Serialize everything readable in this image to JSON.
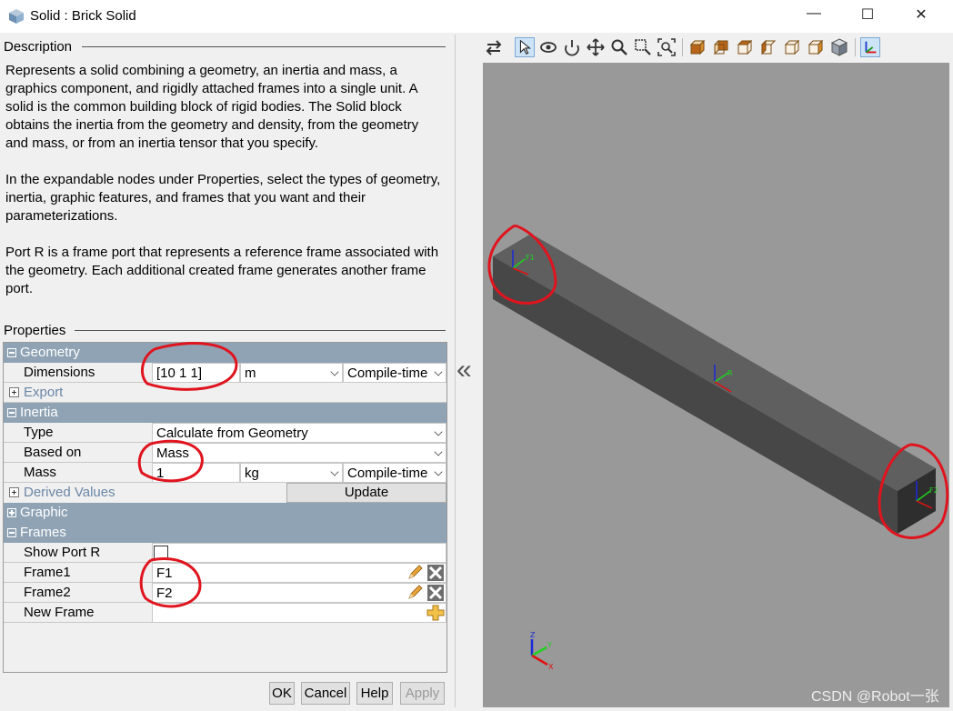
{
  "window": {
    "title": "Solid : Brick Solid",
    "controls": [
      "—",
      "☐",
      "✕"
    ]
  },
  "description": {
    "heading": "Description",
    "paragraphs": [
      "Represents a solid combining a geometry, an inertia and mass, a graphics component, and rigidly attached frames into a single unit. A solid is the common building block of rigid bodies. The Solid block obtains the inertia from the geometry and density, from the geometry and mass, or from an inertia tensor that you specify.",
      "In the expandable nodes under Properties, select the types of geometry, inertia, graphic features, and frames that you want and their parameterizations.",
      "Port R is a frame port that represents a reference frame associated with the geometry. Each additional created frame generates another frame port."
    ]
  },
  "properties": {
    "heading": "Properties",
    "geometry": {
      "label": "Geometry",
      "dimensions": {
        "label": "Dimensions",
        "value": "[10 1 1]",
        "unit": "m",
        "mode": "Compile-time"
      }
    },
    "export": {
      "label": "Export"
    },
    "inertia": {
      "label": "Inertia",
      "type": {
        "label": "Type",
        "value": "Calculate from Geometry"
      },
      "based_on": {
        "label": "Based on",
        "value": "Mass"
      },
      "mass": {
        "label": "Mass",
        "value": "1",
        "unit": "kg",
        "mode": "Compile-time"
      }
    },
    "derived": {
      "label": "Derived Values",
      "button": "Update"
    },
    "graphic": {
      "label": "Graphic"
    },
    "frames": {
      "label": "Frames",
      "show_port_r": {
        "label": "Show Port R",
        "checked": false
      },
      "frame1": {
        "label": "Frame1",
        "value": "F1"
      },
      "frame2": {
        "label": "Frame2",
        "value": "F2"
      },
      "new_frame": {
        "label": "New Frame"
      }
    }
  },
  "buttons": {
    "ok": "OK",
    "cancel": "Cancel",
    "help": "Help",
    "apply": "Apply"
  },
  "viewer": {
    "collapse_glyph": "«",
    "frame_label_f1": "F1",
    "frame_label_center": "R",
    "frame_label_f2": "F2",
    "triad_labels": {
      "x": "X",
      "y": "Y",
      "z": "Z"
    },
    "toolbar_icons": [
      "swap-icon",
      "select-arrow-icon",
      "rotate-icon",
      "roll-icon",
      "pan-icon",
      "zoom-icon",
      "zoom-box-icon",
      "fit-icon",
      "view-front-icon",
      "view-back-icon",
      "view-left-icon",
      "view-right-icon",
      "view-top-icon",
      "view-bottom-icon",
      "view-iso-icon",
      "triad-icon"
    ]
  },
  "watermark": "CSDN @Robot一张",
  "colors": {
    "group_header": "#8fa3b5",
    "viewport_bg": "#999999",
    "annotation_red": "#e0141e"
  }
}
